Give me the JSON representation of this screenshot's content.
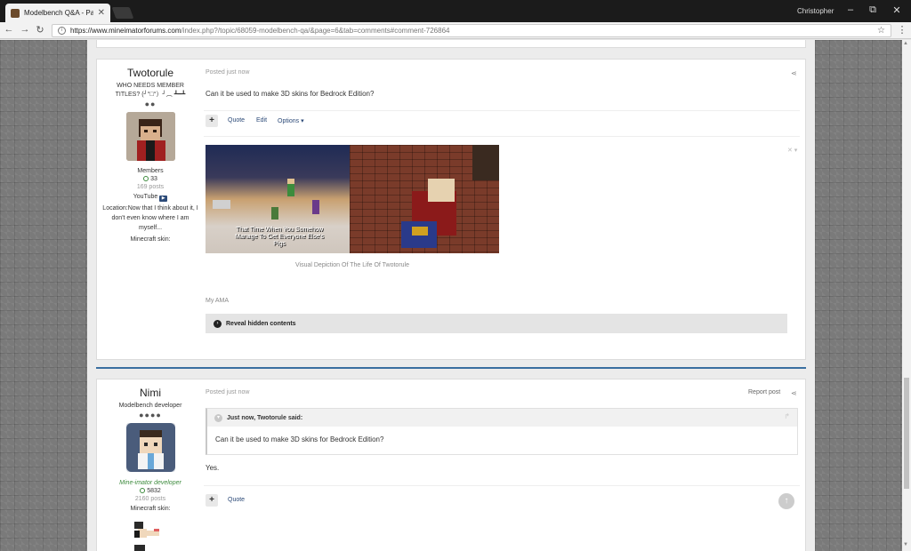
{
  "browser": {
    "tab_title": "Modelbench Q&A - Page",
    "tab_close": "✕",
    "profile": "Christopher",
    "url_domain": "https://www.mineimatorforums.com",
    "url_path": "/index.php?/topic/68059-modelbench-qa/&page=6&tab=comments#comment-726864",
    "window_minimize": "–",
    "window_restore": "⧉",
    "window_close": "✕",
    "back": "←",
    "forward": "→",
    "reload": "↻",
    "star": "☆",
    "menu": "⋮",
    "info": "i"
  },
  "post1": {
    "author": "Twotorule",
    "member_title": "WHO NEEDS MEMBER TITLES? (╯°□°）╯︵ ┻━┻",
    "pips": "●●",
    "group": "Members",
    "reputation": "33",
    "posts": "169 posts",
    "youtube_label": "YouTube",
    "location": "Location:Now that I think about it, I don't even know where I am myself...",
    "skin_label": "Minecraft skin:",
    "posted": "Posted just now",
    "text": "Can it be used to make 3D skins for Bedrock Edition?",
    "plus": "+",
    "quote": "Quote",
    "edit": "Edit",
    "options": "Options",
    "image_overlay": "That Time When You Somehow Manage To Get Everyone Else's Pigs",
    "caption": "Visual Depiction Of The Life Of Twotorule",
    "ama": "My AMA",
    "reveal": "Reveal hidden contents"
  },
  "post2": {
    "author": "Nimi",
    "member_title": "Modelbench developer",
    "pips": "●●●●",
    "dev_title": "Mine-imator developer",
    "reputation": "5832",
    "posts": "2160 posts",
    "skin_label": "Minecraft skin:",
    "posted": "Posted just now",
    "report": "Report post",
    "quote_author": "Just now, Twotorule said:",
    "quote_text": "Can it be used to make 3D skins for Bedrock Edition?",
    "text": "Yes.",
    "plus": "+",
    "quote": "Quote"
  }
}
